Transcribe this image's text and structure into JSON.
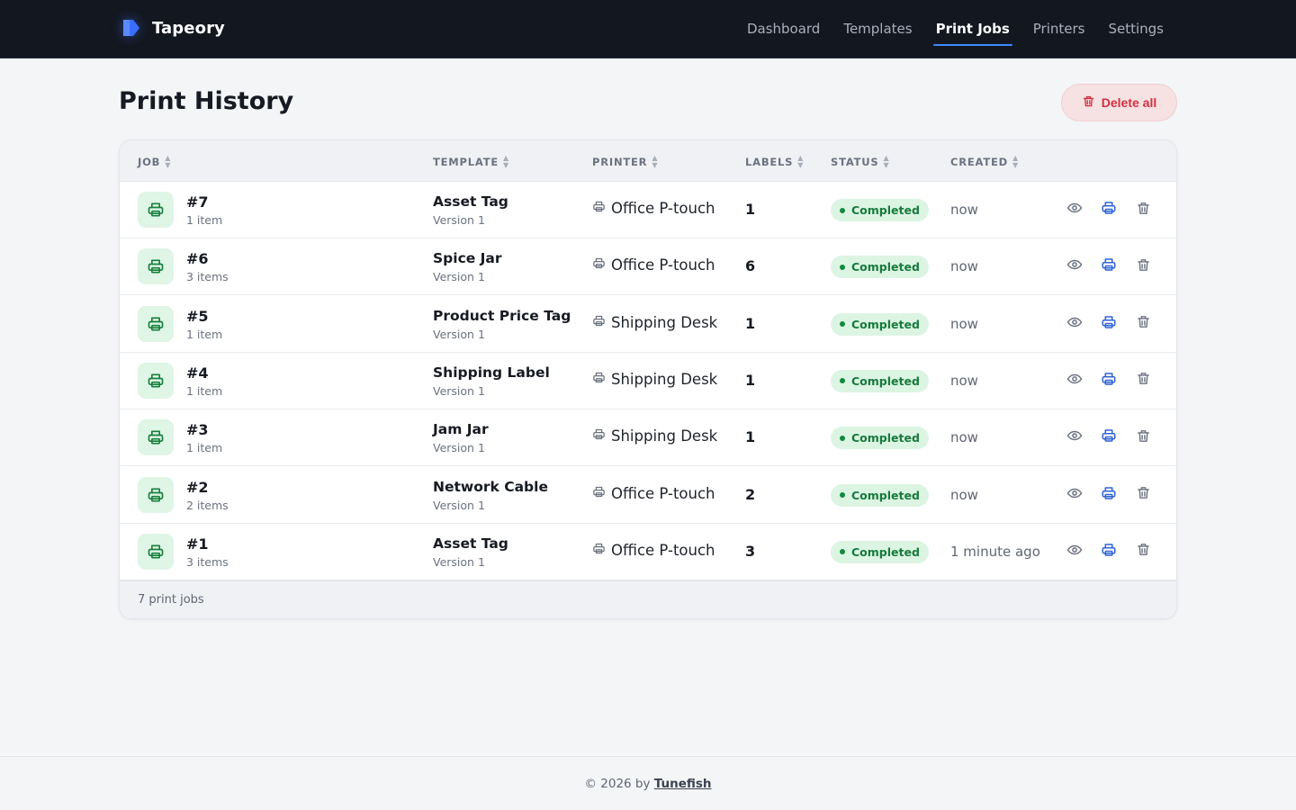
{
  "app": {
    "name": "Tapeory"
  },
  "nav": {
    "items": [
      {
        "label": "Dashboard",
        "active": false
      },
      {
        "label": "Templates",
        "active": false
      },
      {
        "label": "Print Jobs",
        "active": true
      },
      {
        "label": "Printers",
        "active": false
      },
      {
        "label": "Settings",
        "active": false
      }
    ]
  },
  "page": {
    "title": "Print History",
    "delete_all_label": "Delete all"
  },
  "table": {
    "columns": [
      "JOB",
      "TEMPLATE",
      "PRINTER",
      "LABELS",
      "STATUS",
      "CREATED"
    ],
    "rows": [
      {
        "id": "#7",
        "items": "1 item",
        "template": "Asset Tag",
        "version": "Version 1",
        "printer": "Office P-touch",
        "labels": "1",
        "status": "Completed",
        "created": "now"
      },
      {
        "id": "#6",
        "items": "3 items",
        "template": "Spice Jar",
        "version": "Version 1",
        "printer": "Office P-touch",
        "labels": "6",
        "status": "Completed",
        "created": "now"
      },
      {
        "id": "#5",
        "items": "1 item",
        "template": "Product Price Tag",
        "version": "Version 1",
        "printer": "Shipping Desk",
        "labels": "1",
        "status": "Completed",
        "created": "now"
      },
      {
        "id": "#4",
        "items": "1 item",
        "template": "Shipping Label",
        "version": "Version 1",
        "printer": "Shipping Desk",
        "labels": "1",
        "status": "Completed",
        "created": "now"
      },
      {
        "id": "#3",
        "items": "1 item",
        "template": "Jam Jar",
        "version": "Version 1",
        "printer": "Shipping Desk",
        "labels": "1",
        "status": "Completed",
        "created": "now"
      },
      {
        "id": "#2",
        "items": "2 items",
        "template": "Network Cable",
        "version": "Version 1",
        "printer": "Office P-touch",
        "labels": "2",
        "status": "Completed",
        "created": "now"
      },
      {
        "id": "#1",
        "items": "3 items",
        "template": "Asset Tag",
        "version": "Version 1",
        "printer": "Office P-touch",
        "labels": "3",
        "status": "Completed",
        "created": "1 minute ago"
      }
    ],
    "footer_count": "7 print jobs"
  },
  "footer": {
    "prefix": "© 2026 by",
    "link": "Tunefish"
  },
  "icons": {
    "brand": "label-tag-icon",
    "delete_all": "trash-icon",
    "job": "printer-icon",
    "printer": "printer-icon",
    "view": "eye-icon",
    "reprint": "printer-icon",
    "delete": "trash-icon"
  },
  "colors": {
    "accent": "#3f87ff",
    "topbar": "#131720",
    "danger": "#d4303f",
    "success": "#177a3c",
    "success_bg": "#dcf5e3",
    "action_blue": "#2f63d6"
  }
}
